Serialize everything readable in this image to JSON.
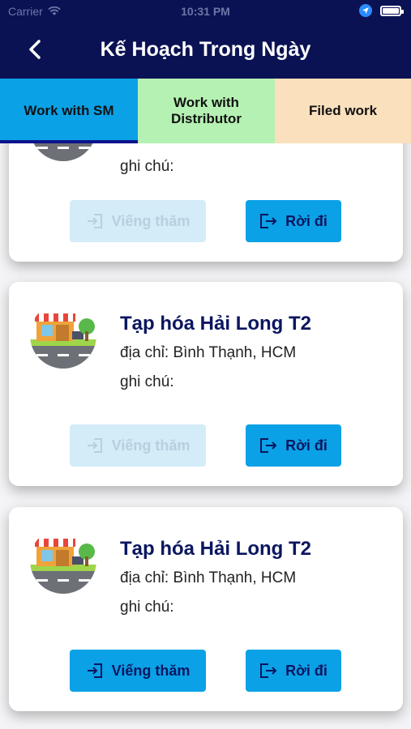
{
  "status_bar": {
    "carrier": "Carrier",
    "time": "10:31 PM"
  },
  "header": {
    "title": "Kế Hoạch Trong Ngày"
  },
  "tabs": [
    {
      "label": "Work with SM",
      "active": true
    },
    {
      "label": "Work with Distributor",
      "active": false
    },
    {
      "label": "Filed work",
      "active": false
    }
  ],
  "cards": [
    {
      "note": "ghi chú:",
      "visit_label": "Viếng thăm",
      "visit_enabled": false,
      "leave_label": "Rời đi"
    },
    {
      "name": "Tạp hóa Hải Long T2",
      "address": "địa chỉ: Bình Thạnh, HCM",
      "note": "ghi chú:",
      "visit_label": "Viếng thăm",
      "visit_enabled": false,
      "leave_label": "Rời đi"
    },
    {
      "name": "Tạp hóa Hải Long T2",
      "address": "địa chỉ: Bình Thạnh, HCM",
      "note": "ghi chú:",
      "visit_label": "Viếng thăm",
      "visit_enabled": true,
      "leave_label": "Rời đi"
    }
  ],
  "icons": {
    "back": "chevron-left-icon",
    "wifi": "wifi-icon",
    "location": "location-arrow-icon",
    "battery": "battery-icon",
    "shop": "shop-icon",
    "login": "login-icon",
    "logout": "logout-icon"
  },
  "colors": {
    "header_bg": "#0a1254",
    "accent": "#0aa1e6",
    "tab_distributor": "#b5f1b2",
    "tab_filed": "#fae0bd",
    "title_text": "#0b1660"
  }
}
